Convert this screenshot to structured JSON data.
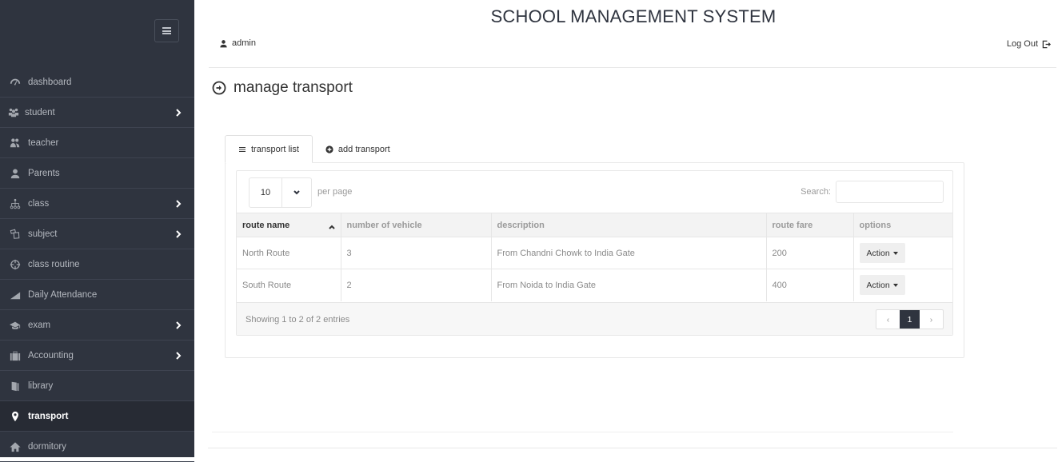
{
  "app": {
    "title": "SCHOOL MANAGEMENT SYSTEM"
  },
  "header": {
    "user_name": "admin",
    "user_icon": "user-icon",
    "logout_label": "Log Out",
    "logout_icon": "logout-icon"
  },
  "sidebar": {
    "toggle_icon": "hamburger-icon",
    "items": [
      {
        "label": "dashboard",
        "icon": "dashboard-gauge-icon",
        "has_submenu": false,
        "active": false
      },
      {
        "label": "student",
        "icon": "users-group-icon",
        "has_submenu": true,
        "active": false
      },
      {
        "label": "teacher",
        "icon": "users-pair-icon",
        "has_submenu": false,
        "active": false
      },
      {
        "label": "Parents",
        "icon": "user-icon",
        "has_submenu": false,
        "active": false
      },
      {
        "label": "class",
        "icon": "sitemap-icon",
        "has_submenu": true,
        "active": false
      },
      {
        "label": "subject",
        "icon": "cards-icon",
        "has_submenu": true,
        "active": false
      },
      {
        "label": "class routine",
        "icon": "crosshair-icon",
        "has_submenu": false,
        "active": false
      },
      {
        "label": "Daily Attendance",
        "icon": "signal-chart-icon",
        "has_submenu": false,
        "active": false
      },
      {
        "label": "exam",
        "icon": "graduation-cap-icon",
        "has_submenu": true,
        "active": false
      },
      {
        "label": "Accounting",
        "icon": "briefcase-icon",
        "has_submenu": true,
        "active": false
      },
      {
        "label": "library",
        "icon": "book-icon",
        "has_submenu": false,
        "active": false
      },
      {
        "label": "transport",
        "icon": "map-marker-icon",
        "has_submenu": false,
        "active": true
      },
      {
        "label": "dormitory",
        "icon": "home-icon",
        "has_submenu": false,
        "active": false
      }
    ]
  },
  "page": {
    "heading": "manage transport",
    "heading_icon": "circle-arrow-right-icon",
    "tabs": [
      {
        "label": "transport list",
        "icon": "list-icon",
        "active": true
      },
      {
        "label": "add transport",
        "icon": "plus-circle-icon",
        "active": false
      }
    ]
  },
  "table_controls": {
    "page_length": "10",
    "per_page_label": "per page",
    "search_label": "Search:",
    "search_value": "",
    "search_placeholder": ""
  },
  "table": {
    "columns": [
      "route name",
      "number of vehicle",
      "description",
      "route fare",
      "options"
    ],
    "sorted_column": "route name",
    "sort_direction": "ascending",
    "rows": [
      {
        "route_name": "North Route",
        "vehicles": "3",
        "description": "From Chandni Chowk to India Gate",
        "fare": "200",
        "action": "Action"
      },
      {
        "route_name": "South Route",
        "vehicles": "2",
        "description": "From Noida to India Gate",
        "fare": "400",
        "action": "Action"
      }
    ]
  },
  "pagination": {
    "info": "Showing 1 to 2 of 2 entries",
    "prev": "‹",
    "current": "1",
    "next": "›"
  }
}
